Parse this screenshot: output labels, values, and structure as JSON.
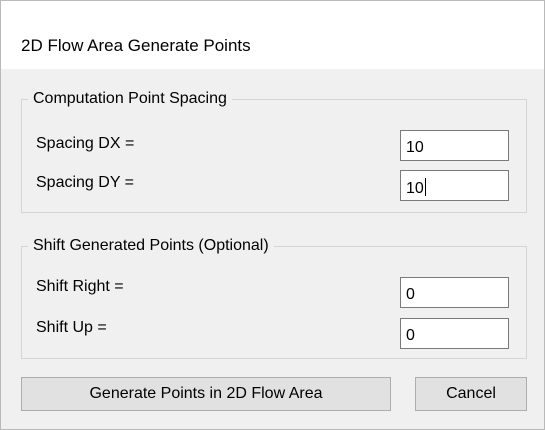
{
  "window": {
    "title": "2D Flow Area Generate Points"
  },
  "spacing_group": {
    "legend": "Computation Point Spacing",
    "dx_label": "Spacing DX =",
    "dx_value": "10",
    "dy_label": "Spacing DY =",
    "dy_value": "10"
  },
  "shift_group": {
    "legend": "Shift Generated Points (Optional)",
    "right_label": "Shift Right =",
    "right_value": "0",
    "up_label": "Shift Up =",
    "up_value": "0"
  },
  "buttons": {
    "generate_label": "Generate Points in 2D Flow Area",
    "cancel_label": "Cancel"
  }
}
